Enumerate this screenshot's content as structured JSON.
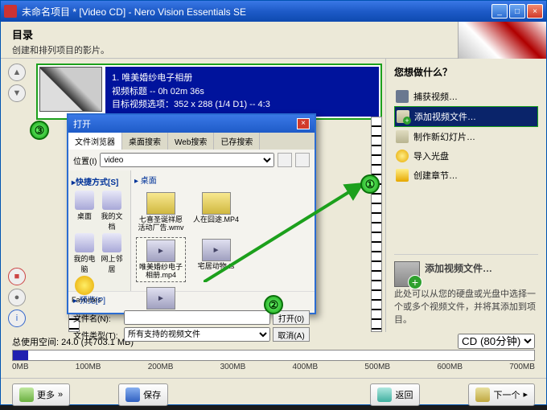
{
  "window": {
    "title": "未命名项目 * [Video CD] - Nero Vision Essentials SE"
  },
  "header": {
    "title": "目录",
    "subtitle": "创建和排列项目的影片。"
  },
  "videoItem": {
    "index": "1.",
    "name": "唯美婚纱电子相册",
    "line2": "视频标题 -- 0h 02m 36s",
    "line3": "目标视频选项：352 x 288 (1/4 D1) -- 4:3"
  },
  "sidebar": {
    "heading": "您想做什么？",
    "items": [
      {
        "label": "捕获视频…"
      },
      {
        "label": "添加视频文件…"
      },
      {
        "label": "制作新幻灯片…"
      },
      {
        "label": "导入光盘"
      },
      {
        "label": "创建章节…"
      }
    ],
    "hint": {
      "title": "添加视频文件…",
      "text": "此处可以从您的硬盘或光盘中选择一个或多个视频文件，并将其添加到项目。"
    }
  },
  "dialog": {
    "title": "打开",
    "tabs": [
      "文件浏览器",
      "桌面搜索",
      "Web搜索",
      "已存搜索"
    ],
    "locationLabel": "位置(I)",
    "locationValue": "video",
    "shortcutHdr": "▸快捷方式[S]",
    "shortcuts": [
      "桌面",
      "我的文档",
      "我的电脑",
      "网上邻居",
      "Favorites"
    ],
    "placesHdr": "▸ 桌面",
    "files": [
      {
        "label": "七喜圣诞祥愿活动厂告.wmv",
        "type": "folder"
      },
      {
        "label": "人在囧途.MP4",
        "type": "folder"
      },
      {
        "label": "唯美婚纱电子相册.mp4",
        "type": "vid",
        "sel": true
      },
      {
        "label": "宅居动物.ts",
        "type": "vid"
      },
      {
        "label": "",
        "type": "vid"
      }
    ],
    "previewLabel": "▸ 预览[P]",
    "filenameLabel": "文件名(N):",
    "filetypeLabel": "文件类型(T):",
    "filetypeValue": "所有支持的视频文件",
    "openBtn": "打开(0)",
    "cancelBtn": "取消(A)"
  },
  "space": {
    "label": "总使用空间: 24.0 (共703.1 MB)",
    "ticks": [
      "0MB",
      "100MB",
      "200MB",
      "300MB",
      "400MB",
      "500MB",
      "600MB",
      "700MB"
    ],
    "fillPercent": 3,
    "discOption": "CD (80分钟)"
  },
  "footer": {
    "more": "更多",
    "save": "保存",
    "back": "返回",
    "next": "下一个"
  },
  "callouts": {
    "c1": "①",
    "c2": "②",
    "c3": "③"
  }
}
